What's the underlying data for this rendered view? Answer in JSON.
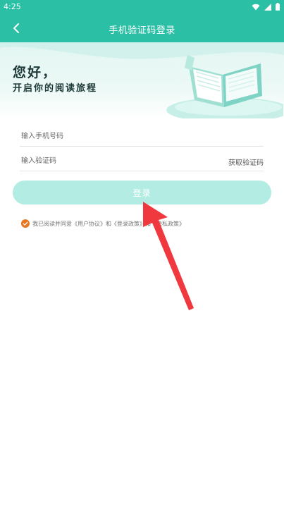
{
  "status_bar": {
    "time": "4:25",
    "icons": [
      "wifi-icon",
      "signal-icon",
      "battery-icon"
    ]
  },
  "header": {
    "title": "手机验证码登录",
    "back_icon": "chevron-left-icon"
  },
  "banner": {
    "greeting": "您好，",
    "subtitle": "开启你的阅读旅程"
  },
  "form": {
    "phone_placeholder": "输入手机号码",
    "code_placeholder": "输入验证码",
    "get_code_label": "获取验证码",
    "login_label": "登录"
  },
  "agreement": {
    "text_prefix": "我已阅读并同意",
    "user_agreement": "《用户协议》",
    "and_1": "和",
    "login_policy": "《登录政策》",
    "and_2": "和",
    "privacy_policy": "《隐私政策》"
  },
  "colors": {
    "accent": "#2bbfa6",
    "button_disabled": "#b3ece3",
    "check": "#e87722",
    "arrow": "#f0383f"
  }
}
